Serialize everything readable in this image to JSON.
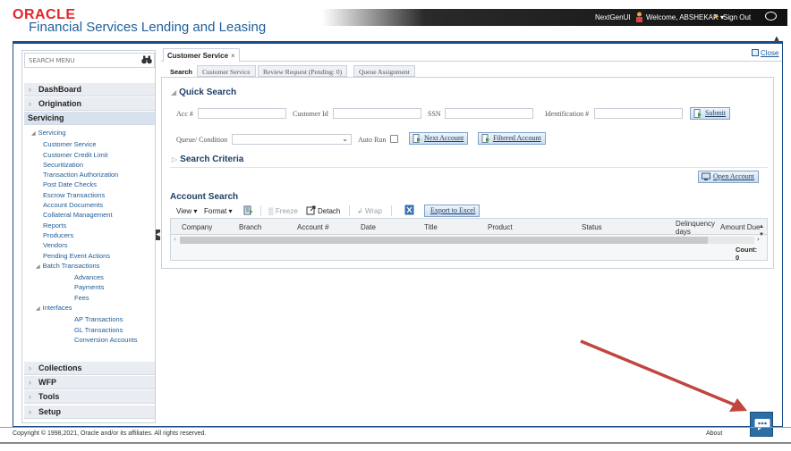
{
  "header": {
    "logo_brand": "ORACLE",
    "logo_product": "Financial Services Lending and Leasing",
    "username": "NextGenUI",
    "welcome": "Welcome, ABSHEKAR ▾",
    "signout": "Sign Out"
  },
  "sidebar": {
    "search_placeholder": "SEARCH MENU",
    "top_menus": [
      "DashBoard",
      "Origination"
    ],
    "active_menu": "Servicing",
    "tree_root": "Servicing",
    "items": [
      "Customer Service",
      "Customer Credit Limit",
      "Securitization",
      "Transaction Authorization",
      "Post Date Checks",
      "Escrow Transactions",
      "Account Documents",
      "Collateral Management",
      "Reports",
      "Producers",
      "Vendors",
      "Pending Event Actions"
    ],
    "batch_group": "Batch Transactions",
    "batch_items": [
      "Advances",
      "Payments",
      "Fees"
    ],
    "interfaces_group": "Interfaces",
    "interfaces_items": [
      "AP Transactions",
      "GL Transactions",
      "Conversion Accounts"
    ],
    "bottom_menus": [
      "Collections",
      "WFP",
      "Tools",
      "Setup"
    ]
  },
  "main_tab": {
    "label": "Customer Service",
    "close": "×"
  },
  "close_label": "Close",
  "subtabs": [
    "Search",
    "Customer Service",
    "Review Request (Pending: 0)",
    "Queue Assignment"
  ],
  "quick_search": {
    "title": "Quick Search",
    "acc_label": "Acc #",
    "customer_id_label": "Customer Id",
    "ssn_label": "SSN",
    "identification_label": "Identification #",
    "submit": "Submit",
    "queue_label": "Queue/ Condition",
    "queue_value": "",
    "auto_run_label": "Auto Run",
    "next_account": "Next Account",
    "filtered_account": "Filtered Account"
  },
  "search_criteria": {
    "title": "Search Criteria"
  },
  "open_account": "Open Account",
  "account_search": {
    "title": "Account Search",
    "view": "View ▾",
    "format": "Format ▾",
    "freeze": "Freeze",
    "detach": "Detach",
    "wrap": "Wrap",
    "export": "Export to Excel",
    "columns": [
      "Company",
      "Branch",
      "Account #",
      "Date",
      "Title",
      "Product",
      "Status",
      "Delinquency days",
      "Amount Due"
    ],
    "count_label": "Count:",
    "count_value": "0"
  },
  "footer": {
    "copyright": "Copyright © 1998,2021, Oracle and/or its affiliates. All rights reserved.",
    "about": "About"
  },
  "colors": {
    "brand_red": "#e4262a",
    "brand_blue": "#1d5f9a",
    "frame_blue": "#1b4b86",
    "link_blue": "#1d5b97",
    "annotation_arrow": "#c0463f",
    "chat_blue": "#2b6fa8"
  }
}
